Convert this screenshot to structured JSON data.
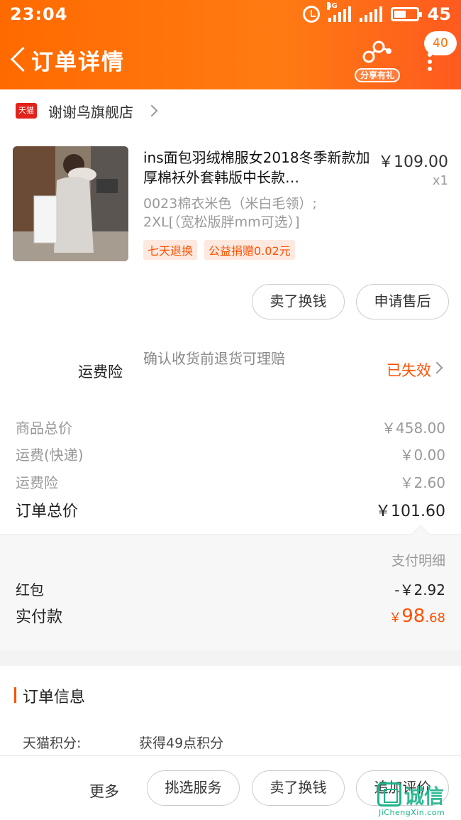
{
  "status_bar": {
    "time": "23:04",
    "network": "4G",
    "battery": "45"
  },
  "nav": {
    "title": "订单详情",
    "share_label": "分享有礼",
    "badge_count": "40"
  },
  "store": {
    "platform_tag": "天猫",
    "name": "谢谢鸟旗舰店"
  },
  "product": {
    "title": "ins面包羽绒棉服女2018冬季新款加厚棉袄外套韩版中长款…",
    "price": "￥109.00",
    "quantity": "x1",
    "spec": "0023棉衣米色（米白毛领）; 2XL[（宽松版胖mm可选）]",
    "tags": [
      "七天退换",
      "公益捐赠0.02元"
    ]
  },
  "actions": {
    "sell_button": "卖了换钱",
    "after_sale_button": "申请售后"
  },
  "insurance": {
    "label": "运费险",
    "description": "确认收货前退货可理赔",
    "status": "已失效"
  },
  "fees": [
    {
      "label": "商品总价",
      "value": "￥458.00"
    },
    {
      "label": "运费(快递)",
      "value": "￥0.00"
    },
    {
      "label": "运费险",
      "value": "￥2.60"
    }
  ],
  "order_total": {
    "label": "订单总价",
    "value": "￥101.60"
  },
  "payment": {
    "detail_label": "支付明细",
    "red_packet_label": "红包",
    "red_packet_value": "-￥2.92",
    "paid_label": "实付款",
    "paid_symbol": "￥",
    "paid_int": "98",
    "paid_dec": ".68"
  },
  "order_info": {
    "title": "订单信息",
    "points_label": "天猫积分:",
    "points_value": "获得49点积分"
  },
  "bottom_bar": {
    "more": "更多",
    "select_service": "挑选服务",
    "sell": "卖了换钱",
    "add_review": "追加评价"
  },
  "watermark": {
    "brand": "诚信",
    "url": "JiChengXin.com"
  },
  "colors": {
    "accent": "#ff5000",
    "header": "#ff6a00"
  }
}
